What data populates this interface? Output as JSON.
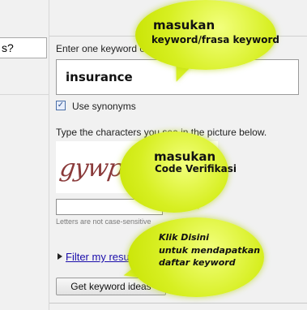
{
  "left": {
    "field_text": "s?"
  },
  "form": {
    "keyword_label": "Enter one keyword or phrase per line:",
    "keyword_value": "insurance",
    "synonyms_label": "Use synonyms",
    "captcha_label": "Type the characters you see in the picture below.",
    "captcha_text": "gywphing",
    "case_note": "Letters are not case-sensitive",
    "filter_link": "Filter my results",
    "button_label": "Get keyword ideas"
  },
  "bubbles": {
    "b1": {
      "title": "masukan",
      "subtitle": "keyword/frasa keyword"
    },
    "b2": {
      "title": "masukan",
      "subtitle": "Code Verifikasi"
    },
    "b3": {
      "line1": "Klik Disini",
      "line2": "untuk mendapatkan",
      "line3": "daftar keyword"
    }
  },
  "colors": {
    "bubble": "#d7ef22",
    "link": "#1a0dab"
  }
}
